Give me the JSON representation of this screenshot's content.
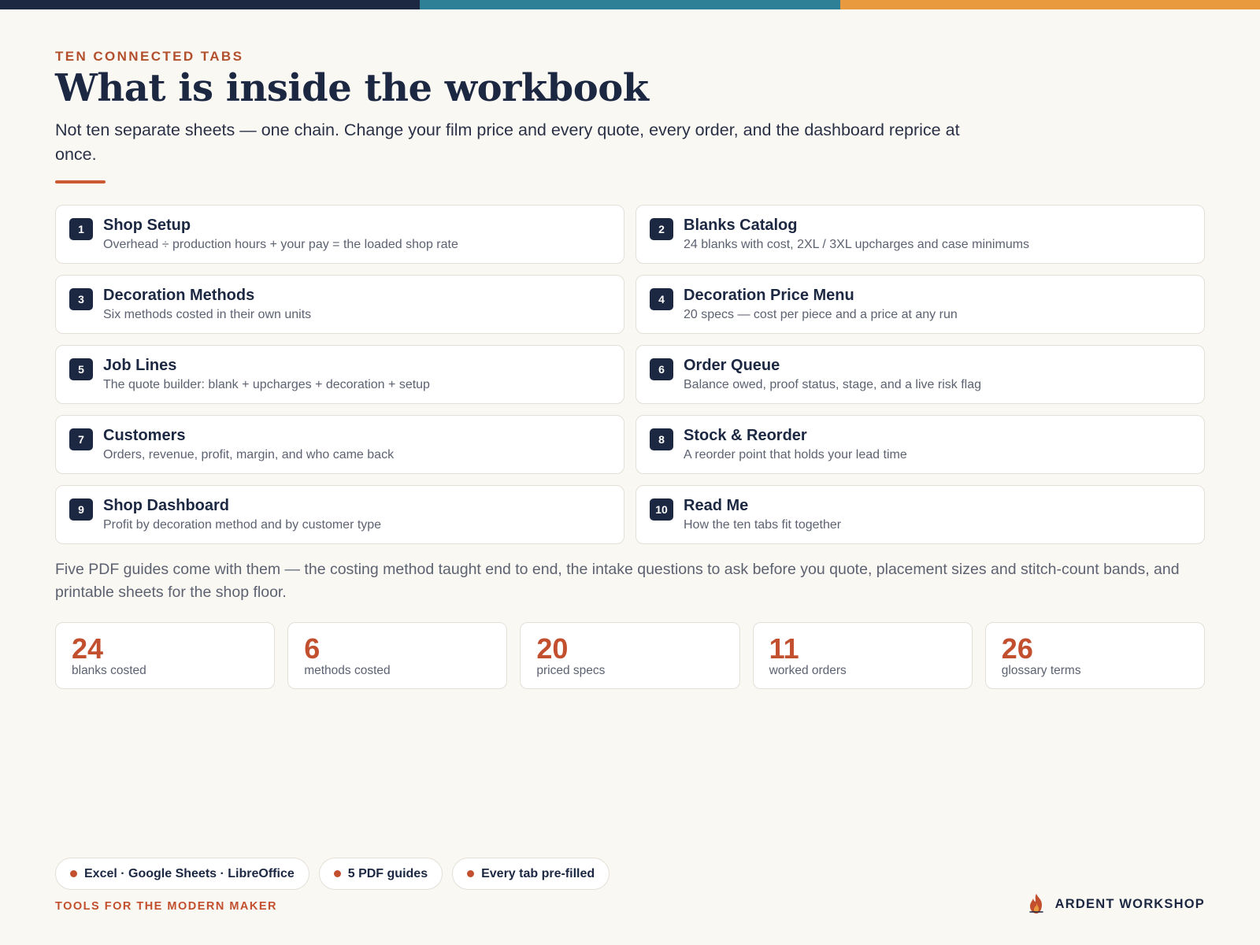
{
  "colors": {
    "navy": "#1c2742",
    "teal": "#2e8096",
    "orange": "#ea9a3e",
    "accent": "#c2502f",
    "background": "#faf8f2"
  },
  "header": {
    "eyebrow": "TEN CONNECTED TABS",
    "title": "What is inside the workbook",
    "intro": "Not ten separate sheets — one chain. Change your film price and every quote, every order, and the dashboard reprice at once."
  },
  "tabs": [
    {
      "number": "1",
      "name": "Shop Setup",
      "description": "Overhead ÷ production hours + your pay = the loaded shop rate"
    },
    {
      "number": "2",
      "name": "Blanks Catalog",
      "description": "24 blanks with cost, 2XL / 3XL upcharges and case minimums"
    },
    {
      "number": "3",
      "name": "Decoration Methods",
      "description": "Six methods costed in their own units"
    },
    {
      "number": "4",
      "name": "Decoration Price Menu",
      "description": "20 specs — cost per piece and a price at any run"
    },
    {
      "number": "5",
      "name": "Job Lines",
      "description": "The quote builder: blank + upcharges + decoration + setup"
    },
    {
      "number": "6",
      "name": "Order Queue",
      "description": "Balance owed, proof status, stage, and a live risk flag"
    },
    {
      "number": "7",
      "name": "Customers",
      "description": "Orders, revenue, profit, margin, and who came back"
    },
    {
      "number": "8",
      "name": "Stock & Reorder",
      "description": "A reorder point that holds your lead time"
    },
    {
      "number": "9",
      "name": "Shop Dashboard",
      "description": "Profit by decoration method and by customer type"
    },
    {
      "number": "10",
      "name": "Read Me",
      "description": "How the ten tabs fit together"
    }
  ],
  "guides_text": "Five PDF guides come with them — the costing method taught end to end, the intake questions to ask before you quote, placement sizes and stitch-count bands, and printable sheets for the shop floor.",
  "stats": [
    {
      "value": "24",
      "label": "blanks costed"
    },
    {
      "value": "6",
      "label": "methods costed"
    },
    {
      "value": "20",
      "label": "priced specs"
    },
    {
      "value": "11",
      "label": "worked orders"
    },
    {
      "value": "26",
      "label": "glossary terms"
    }
  ],
  "badges": [
    {
      "label": "Excel · Google Sheets · LibreOffice"
    },
    {
      "label": "5 PDF guides"
    },
    {
      "label": "Every tab pre-filled"
    }
  ],
  "footer": {
    "tagline": "TOOLS FOR THE MODERN MAKER",
    "brand_icon": "flame-icon",
    "brand_name": "ARDENT WORKSHOP"
  }
}
